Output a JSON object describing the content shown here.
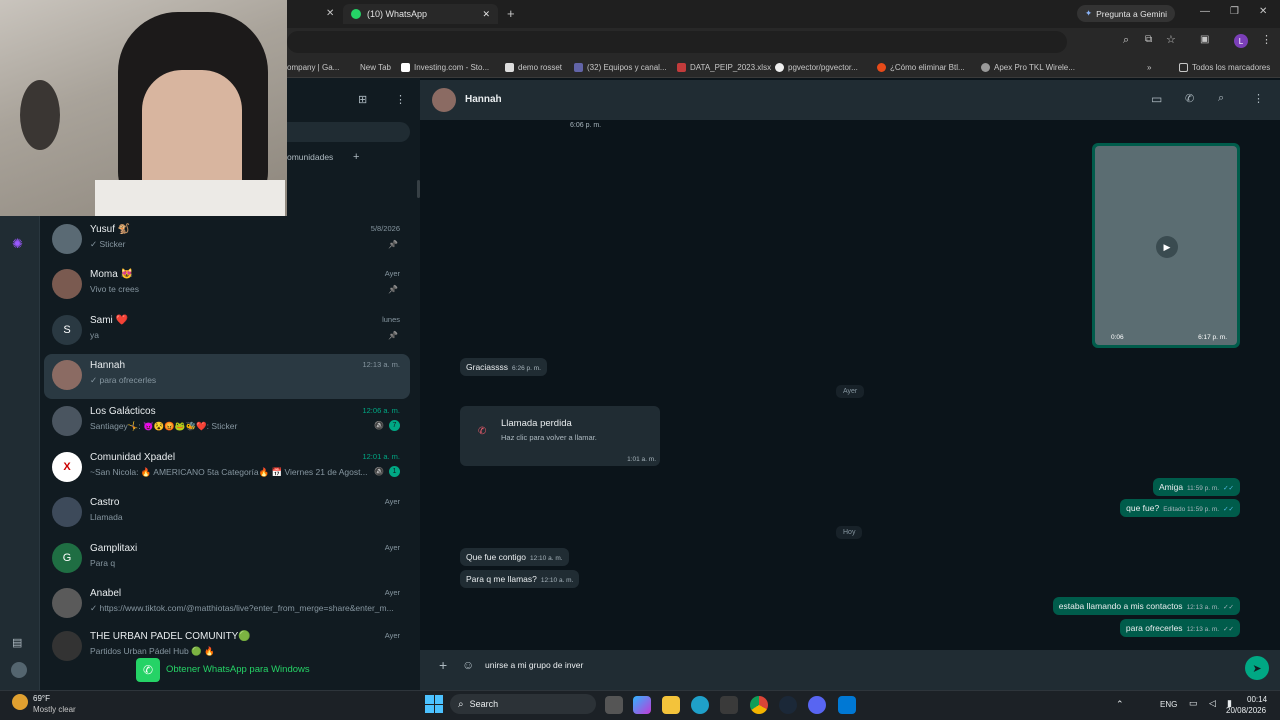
{
  "browser": {
    "tabs": [
      {
        "label": "(10) WhatsApp",
        "active": true
      }
    ],
    "gemini_label": "Pregunta a Gemini",
    "bookmarks": [
      "ompany | Ga...",
      "New Tab",
      "Investing.com - Sto...",
      "demo rosset",
      "(32) Equipos y canal...",
      "DATA_PEIP_2023.xlsx",
      "pgvector/pgvector...",
      "¿Cómo eliminar Btl...",
      "Apex Pro TKL Wirele..."
    ],
    "all_bookmarks": "Todos los marcadores",
    "profile_initial": "L"
  },
  "sidebar": {
    "filter_chip": "omunidades",
    "chats": [
      {
        "name": "Yusuf 🐒",
        "preview": "✓ Sticker",
        "time": "5/8/2026",
        "pin": true,
        "avatar_color": "#5a6a74"
      },
      {
        "name": "Moma 😻",
        "preview": "Vivo te crees",
        "time": "Ayer",
        "pin": true,
        "avatar_color": "#7a5a50"
      },
      {
        "name": "Sami ❤️",
        "preview": "ya",
        "time": "lunes",
        "pin": true,
        "avatar_letter": "S",
        "avatar_color": "#2a3942"
      },
      {
        "name": "Hannah",
        "preview": "✓ para ofrecerles",
        "time": "12:13 a. m.",
        "selected": true,
        "avatar_color": "#8b6b63"
      },
      {
        "name": "Los Galácticos",
        "preview": "Santiagey🤸: 😈😵😡🐸🐝❤️: Sticker",
        "time": "12:06 a. m.",
        "time_green": true,
        "badge": "7",
        "muted": true,
        "avatar_color": "#4a5560"
      },
      {
        "name": "Comunidad Xpadel",
        "preview": "~San Nicola: 🔥 AMERICANO 5ta Categoría🔥 📅 Viernes 21 de Agost...",
        "time": "12:01 a. m.",
        "time_green": true,
        "badge": "1",
        "muted": true,
        "avatar_letter": "X",
        "avatar_color": "#ffffff"
      },
      {
        "name": "Castro",
        "preview": "Llamada",
        "time": "Ayer",
        "avatar_color": "#3d4a5a"
      },
      {
        "name": "Gamplitaxi",
        "preview": "Para q",
        "time": "Ayer",
        "avatar_letter": "G",
        "avatar_color": "#1f6e43"
      },
      {
        "name": "Anabel",
        "preview": "✓ https://www.tiktok.com/@matthiotas/live?enter_from_merge=share&enter_m...",
        "time": "Ayer",
        "avatar_color": "#5a5a5a"
      },
      {
        "name": "THE URBAN PADEL COMUNITY🟢",
        "preview": "Partidos Urban Pádel Hub 🟢 🔥",
        "time": "Ayer",
        "avatar_color": "#333"
      }
    ],
    "get_app": "Obtener WhatsApp para Windows"
  },
  "chat": {
    "contact": "Hannah",
    "messages": {
      "top_time": "6:06 p. m.",
      "video_duration": "0:06",
      "video_time": "6:17 p. m.",
      "m1": {
        "text": "Graciassss",
        "time": "6:26 p. m."
      },
      "day_ayer": "Ayer",
      "missed": {
        "title": "Llamada perdida",
        "sub": "Haz clic para volver a llamar.",
        "time": "1:01 a. m."
      },
      "m2": {
        "text": "Amiga",
        "time": "11:59 p. m."
      },
      "m3": {
        "text": "que fue?",
        "time": "Editado 11:59 p. m."
      },
      "day_hoy": "Hoy",
      "m4": {
        "text": "Que fue contigo",
        "time": "12:10 a. m."
      },
      "m5": {
        "text": "Para q me llamas?",
        "time": "12:10 a. m."
      },
      "m6": {
        "text": "estaba llamando a mis contactos",
        "time": "12:13 a. m."
      },
      "m7": {
        "text": "para ofrecerles",
        "time": "12:13 a. m."
      }
    },
    "composer": "unirse a mi grupo de inver"
  },
  "taskbar": {
    "weather_temp": "69°F",
    "weather_desc": "Mostly clear",
    "search": "Search",
    "lang": "ENG",
    "time": "00:14",
    "date": "20/08/2026"
  }
}
